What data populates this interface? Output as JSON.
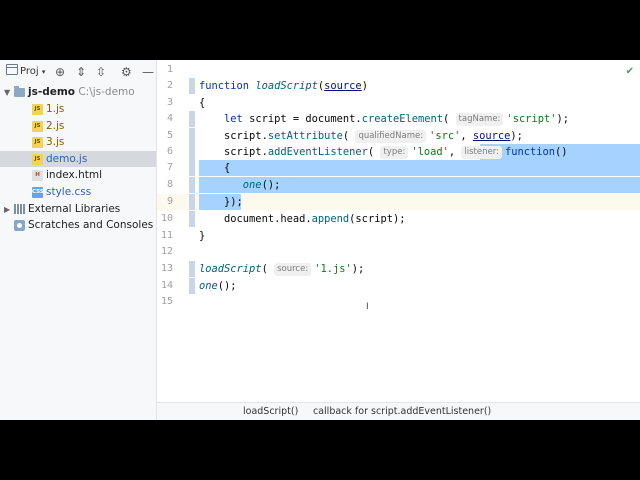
{
  "project_panel": {
    "title": "Proj",
    "tree": [
      {
        "label": "js-demo",
        "hint": "C:\\js-demo"
      },
      {
        "label": "1.js"
      },
      {
        "label": "2.js"
      },
      {
        "label": "3.js"
      },
      {
        "label": "demo.js"
      },
      {
        "label": "index.html"
      },
      {
        "label": "style.css"
      },
      {
        "label": "External Libraries"
      },
      {
        "label": "Scratches and Consoles"
      }
    ]
  },
  "editor": {
    "line_numbers": [
      "1",
      "2",
      "3",
      "4",
      "5",
      "6",
      "7",
      "8",
      "9",
      "10",
      "11",
      "12",
      "13",
      "14",
      "15"
    ],
    "l2": {
      "kw": "function",
      "fn": "loadScript",
      "open": "(",
      "param": "source",
      "close": ")"
    },
    "l3": "{",
    "l4": {
      "kw": "let",
      "var": "script = document.",
      "method": "createElement",
      "open": "(",
      "hint": "tagName:",
      "arg": "'script'",
      "close": ");"
    },
    "l5": {
      "obj": "script.",
      "method": "setAttribute",
      "open": "(",
      "hint": "qualifiedName:",
      "arg": "'src'",
      "sep": ", ",
      "param": "source",
      "close": ");"
    },
    "l6": {
      "obj": "script.",
      "method": "addEventListener",
      "open": "(",
      "hint1": "type:",
      "arg": "'load'",
      "sep": ",",
      "hint2": "listener:",
      "kw": "function",
      "close": "()"
    },
    "l7": "{",
    "l8": {
      "fn": "one",
      "rest": "();"
    },
    "l9": "});",
    "l10": {
      "obj": "document.head.",
      "method": "append",
      "rest": "(script);"
    },
    "l11": "}",
    "l13": {
      "fn": "loadScript",
      "open": "(",
      "hint": "source:",
      "arg": "'1.js'",
      "close": ");"
    },
    "l14": {
      "fn": "one",
      "rest": "();"
    }
  },
  "breadcrumb": {
    "items": [
      "loadScript()",
      "callback for script.addEventListener()"
    ]
  },
  "colors": {
    "selection": "#a6d2ff",
    "keyword": "#0033b3",
    "string": "#067d17"
  }
}
